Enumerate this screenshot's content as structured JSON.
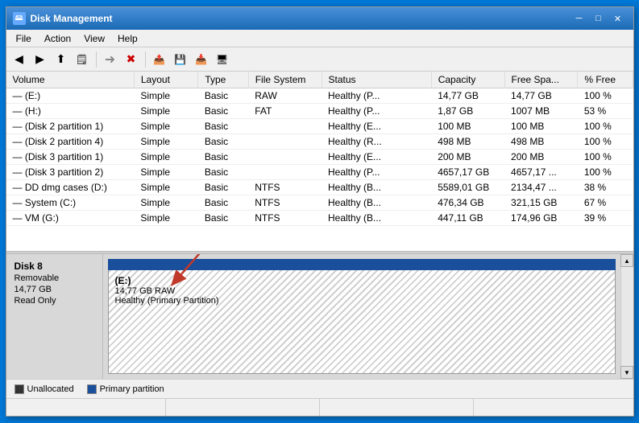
{
  "window": {
    "title": "Disk Management",
    "icon": "💾"
  },
  "titlebar_buttons": {
    "minimize": "─",
    "maximize": "□",
    "close": "✕"
  },
  "menu": {
    "items": [
      "File",
      "Action",
      "View",
      "Help"
    ]
  },
  "toolbar": {
    "buttons": [
      "◀",
      "▶",
      "⬆",
      "📋",
      "🗑",
      "✕",
      "📁",
      "💾",
      "📤",
      "📥"
    ]
  },
  "table": {
    "columns": [
      "Volume",
      "Layout",
      "Type",
      "File System",
      "Status",
      "Capacity",
      "Free Spa...",
      "% Free"
    ],
    "rows": [
      {
        "volume": "— (E:)",
        "layout": "Simple",
        "type": "Basic",
        "fs": "RAW",
        "status": "Healthy (P...",
        "capacity": "14,77 GB",
        "free": "14,77 GB",
        "pct": "100 %"
      },
      {
        "volume": "— (H:)",
        "layout": "Simple",
        "type": "Basic",
        "fs": "FAT",
        "status": "Healthy (P...",
        "capacity": "1,87 GB",
        "free": "1007 MB",
        "pct": "53 %"
      },
      {
        "volume": "— (Disk 2 partition 1)",
        "layout": "Simple",
        "type": "Basic",
        "fs": "",
        "status": "Healthy (E...",
        "capacity": "100 MB",
        "free": "100 MB",
        "pct": "100 %"
      },
      {
        "volume": "— (Disk 2 partition 4)",
        "layout": "Simple",
        "type": "Basic",
        "fs": "",
        "status": "Healthy (R...",
        "capacity": "498 MB",
        "free": "498 MB",
        "pct": "100 %"
      },
      {
        "volume": "— (Disk 3 partition 1)",
        "layout": "Simple",
        "type": "Basic",
        "fs": "",
        "status": "Healthy (E...",
        "capacity": "200 MB",
        "free": "200 MB",
        "pct": "100 %"
      },
      {
        "volume": "— (Disk 3 partition 2)",
        "layout": "Simple",
        "type": "Basic",
        "fs": "",
        "status": "Healthy (P...",
        "capacity": "4657,17 GB",
        "free": "4657,17 ...",
        "pct": "100 %"
      },
      {
        "volume": "— DD dmg cases (D:)",
        "layout": "Simple",
        "type": "Basic",
        "fs": "NTFS",
        "status": "Healthy (B...",
        "capacity": "5589,01 GB",
        "free": "2134,47 ...",
        "pct": "38 %"
      },
      {
        "volume": "— System (C:)",
        "layout": "Simple",
        "type": "Basic",
        "fs": "NTFS",
        "status": "Healthy (B...",
        "capacity": "476,34 GB",
        "free": "321,15 GB",
        "pct": "67 %"
      },
      {
        "volume": "— VM (G:)",
        "layout": "Simple",
        "type": "Basic",
        "fs": "NTFS",
        "status": "Healthy (B...",
        "capacity": "447,11 GB",
        "free": "174,96 GB",
        "pct": "39 %"
      }
    ]
  },
  "disk_panel": {
    "name": "Disk 8",
    "type": "Removable",
    "size": "14,77 GB",
    "access": "Read Only",
    "partition_label": "(E:)",
    "partition_size": "14,77 GB RAW",
    "partition_status": "Healthy (Primary Partition)"
  },
  "legend": {
    "items": [
      {
        "color": "#222",
        "label": "Unallocated"
      },
      {
        "color": "#1a4f9c",
        "label": "Primary partition"
      }
    ]
  },
  "status_bar": {
    "segments": [
      "",
      "",
      "",
      ""
    ]
  }
}
